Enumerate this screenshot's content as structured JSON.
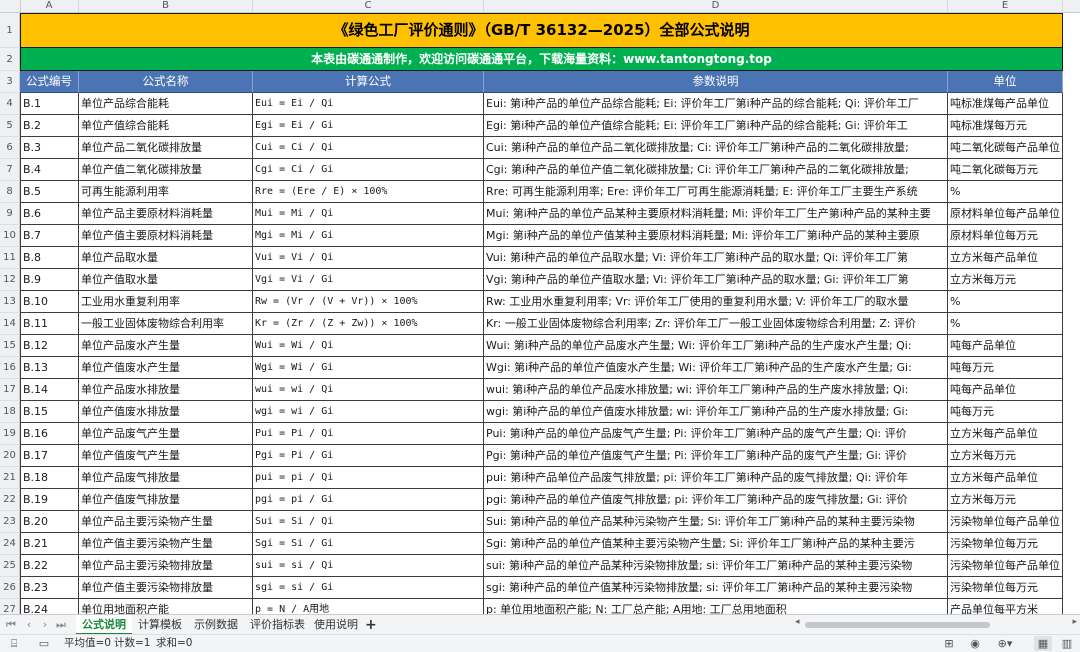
{
  "columns": [
    "A",
    "B",
    "C",
    "D",
    "E"
  ],
  "title": "《绿色工厂评价通则》（GB/T 36132—2025）全部公式说明",
  "subtitle": "本表由碳通通制作，欢迎访问碳通通平台，下载海量资料：www.tantongtong.top",
  "headers": [
    "公式编号",
    "公式名称",
    "计算公式",
    "参数说明",
    "单位"
  ],
  "header_row_numbers": [
    "1",
    "2",
    "3"
  ],
  "rows": [
    {
      "n": "4",
      "id": "B.1",
      "name": "单位产品综合能耗",
      "formula": "Eui = Ei / Qi",
      "desc": "Eui: 第i种产品的单位产品综合能耗; Ei: 评价年工厂第i种产品的综合能耗; Qi: 评价年工厂",
      "unit": "吨标准煤每产品单位"
    },
    {
      "n": "5",
      "id": "B.2",
      "name": "单位产值综合能耗",
      "formula": "Egi = Ei / Gi",
      "desc": "Egi: 第i种产品的单位产值综合能耗; Ei: 评价年工厂第i种产品的综合能耗; Gi: 评价年工",
      "unit": "吨标准煤每万元"
    },
    {
      "n": "6",
      "id": "B.3",
      "name": "单位产品二氧化碳排放量",
      "formula": "Cui = Ci / Qi",
      "desc": "Cui: 第i种产品的单位产品二氧化碳排放量; Ci: 评价年工厂第i种产品的二氧化碳排放量;",
      "unit": "吨二氧化碳每产品单位"
    },
    {
      "n": "7",
      "id": "B.4",
      "name": "单位产值二氧化碳排放量",
      "formula": "Cgi = Ci / Gi",
      "desc": "Cgi: 第i种产品的单位产值二氧化碳排放量; Ci: 评价年工厂第i种产品的二氧化碳排放量;",
      "unit": "吨二氧化碳每万元"
    },
    {
      "n": "8",
      "id": "B.5",
      "name": "可再生能源利用率",
      "formula": "Rre = (Ere / E) × 100%",
      "desc": "Rre: 可再生能源利用率; Ere: 评价年工厂可再生能源消耗量; E: 评价年工厂主要生产系统",
      "unit": "%"
    },
    {
      "n": "9",
      "id": "B.6",
      "name": "单位产品主要原材料消耗量",
      "formula": "Mui = Mi / Qi",
      "desc": "Mui: 第i种产品的单位产品某种主要原材料消耗量; Mi: 评价年工厂生产第i种产品的某种主要",
      "unit": "原材料单位每产品单位"
    },
    {
      "n": "10",
      "id": "B.7",
      "name": "单位产值主要原材料消耗量",
      "formula": "Mgi = Mi / Gi",
      "desc": "Mgi: 第i种产品的单位产值某种主要原材料消耗量; Mi: 评价年工厂第i种产品的某种主要原",
      "unit": "原材料单位每万元"
    },
    {
      "n": "11",
      "id": "B.8",
      "name": "单位产品取水量",
      "formula": "Vui = Vi / Qi",
      "desc": "Vui: 第i种产品的单位产品取水量; Vi: 评价年工厂第i种产品的取水量; Qi: 评价年工厂第",
      "unit": "立方米每产品单位"
    },
    {
      "n": "12",
      "id": "B.9",
      "name": "单位产值取水量",
      "formula": "Vgi = Vi / Gi",
      "desc": "Vgi: 第i种产品的单位产值取水量; Vi: 评价年工厂第i种产品的取水量; Gi: 评价年工厂第",
      "unit": "立方米每万元"
    },
    {
      "n": "13",
      "id": "B.10",
      "name": "工业用水重复利用率",
      "formula": "Rw = (Vr / (V + Vr)) × 100%",
      "desc": "Rw: 工业用水重复利用率; Vr: 评价年工厂使用的重复利用水量; V: 评价年工厂的取水量",
      "unit": "%"
    },
    {
      "n": "14",
      "id": "B.11",
      "name": "一般工业固体废物综合利用率",
      "formula": "Kr = (Zr / (Z + Zw)) × 100%",
      "desc": "Kr: 一般工业固体废物综合利用率; Zr: 评价年工厂一般工业固体废物综合利用量; Z: 评价",
      "unit": "%"
    },
    {
      "n": "15",
      "id": "B.12",
      "name": "单位产品废水产生量",
      "formula": "Wui = Wi / Qi",
      "desc": "Wui: 第i种产品的单位产品废水产生量; Wi: 评价年工厂第i种产品的生产废水产生量; Qi:",
      "unit": "吨每产品单位"
    },
    {
      "n": "16",
      "id": "B.13",
      "name": "单位产值废水产生量",
      "formula": "Wgi = Wi / Gi",
      "desc": "Wgi: 第i种产品的单位产值废水产生量; Wi: 评价年工厂第i种产品的生产废水产生量; Gi:",
      "unit": "吨每万元"
    },
    {
      "n": "17",
      "id": "B.14",
      "name": "单位产品废水排放量",
      "formula": "wui = wi / Qi",
      "desc": "wui: 第i种产品的单位产品废水排放量; wi: 评价年工厂第i种产品的生产废水排放量; Qi:",
      "unit": "吨每产品单位"
    },
    {
      "n": "18",
      "id": "B.15",
      "name": "单位产值废水排放量",
      "formula": "wgi = wi / Gi",
      "desc": "wgi: 第i种产品的单位产值废水排放量; wi: 评价年工厂第i种产品的生产废水排放量; Gi:",
      "unit": "吨每万元"
    },
    {
      "n": "19",
      "id": "B.16",
      "name": "单位产品废气产生量",
      "formula": "Pui = Pi / Qi",
      "desc": "Pui: 第i种产品的单位产品废气产生量; Pi: 评价年工厂第i种产品的废气产生量; Qi: 评价",
      "unit": "立方米每产品单位"
    },
    {
      "n": "20",
      "id": "B.17",
      "name": "单位产值废气产生量",
      "formula": "Pgi = Pi / Gi",
      "desc": "Pgi: 第i种产品的单位产值废气产生量; Pi: 评价年工厂第i种产品的废气产生量; Gi: 评价",
      "unit": "立方米每万元"
    },
    {
      "n": "21",
      "id": "B.18",
      "name": "单位产品废气排放量",
      "formula": "pui = pi / Qi",
      "desc": "pui: 第i种产品单位产品废气排放量; pi: 评价年工厂第i种产品的废气排放量; Qi: 评价年",
      "unit": "立方米每产品单位"
    },
    {
      "n": "22",
      "id": "B.19",
      "name": "单位产值废气排放量",
      "formula": "pgi = pi / Gi",
      "desc": "pgi: 第i种产品的单位产值废气排放量; pi: 评价年工厂第i种产品的废气排放量; Gi: 评价",
      "unit": "立方米每万元"
    },
    {
      "n": "23",
      "id": "B.20",
      "name": "单位产品主要污染物产生量",
      "formula": "Sui = Si / Qi",
      "desc": "Sui: 第i种产品的单位产品某种污染物产生量; Si: 评价年工厂第i种产品的某种主要污染物",
      "unit": "污染物单位每产品单位"
    },
    {
      "n": "24",
      "id": "B.21",
      "name": "单位产值主要污染物产生量",
      "formula": "Sgi = Si / Gi",
      "desc": "Sgi: 第i种产品的单位产值某种主要污染物产生量; Si: 评价年工厂第i种产品的某种主要污",
      "unit": "污染物单位每万元"
    },
    {
      "n": "25",
      "id": "B.22",
      "name": "单位产品主要污染物排放量",
      "formula": "sui = si / Qi",
      "desc": "sui: 第i种产品的单位产品某种污染物排放量; si: 评价年工厂第i种产品的某种主要污染物",
      "unit": "污染物单位每产品单位"
    },
    {
      "n": "26",
      "id": "B.23",
      "name": "单位产值主要污染物排放量",
      "formula": "sgi = si / Gi",
      "desc": "sgi: 第i种产品的单位产值某种污染物排放量; si: 评价年工厂第i种产品的某种主要污染物",
      "unit": "污染物单位每万元"
    },
    {
      "n": "27",
      "id": "B.24",
      "name": "单位用地面积产能",
      "formula": "p = N / A用地",
      "desc": "p: 单位用地面积产能; N: 工厂总产能; A用地: 工厂总用地面积",
      "unit": "产品单位每平方米"
    }
  ],
  "sheet_tabs": [
    {
      "label": "公式说明",
      "active": true
    },
    {
      "label": "计算模板",
      "active": false
    },
    {
      "label": "示例数据",
      "active": false
    },
    {
      "label": "评价指标表",
      "active": false
    },
    {
      "label": "使用说明",
      "active": false
    }
  ],
  "add_tab_label": "+",
  "status": {
    "average": "平均值=0",
    "count": "计数=1",
    "sum": "求和=0"
  },
  "colors": {
    "title_bg": "#ffc000",
    "subtitle_bg": "#00b050",
    "header_bg": "#4a74b3",
    "active_tab": "#1a8a3a"
  },
  "icons": {
    "nav": [
      "first-sheet-icon",
      "prev-sheet-icon",
      "next-sheet-icon",
      "last-sheet-icon"
    ],
    "status": [
      "cell-mode-icon",
      "table-icon",
      "eye-protection-icon",
      "crosshair-icon",
      "normal-view-icon",
      "page-view-icon"
    ]
  }
}
